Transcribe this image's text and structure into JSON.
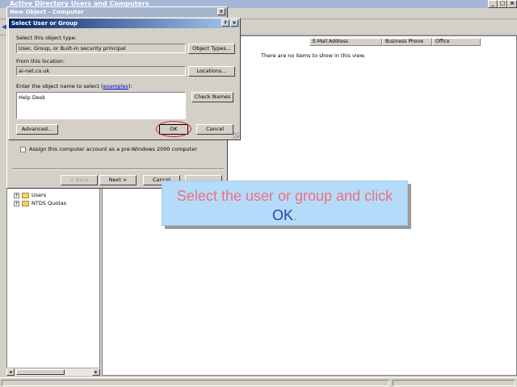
{
  "main_window": {
    "title": "Active Directory Users and Computers",
    "controls": {
      "minimize": "_",
      "maximize": "□",
      "close": "×"
    }
  },
  "tree": {
    "items": [
      {
        "expander": "+",
        "label": "Users"
      },
      {
        "expander": "+",
        "label": "NTDS Quotas"
      }
    ]
  },
  "list": {
    "columns": [
      "E-Mail Address",
      "Business Phone",
      "Office"
    ],
    "empty_message": "There are no items to show in this view."
  },
  "new_object_dialog": {
    "title": "New Object - Computer",
    "close": "×",
    "assign_label": "Assign this computer account as a pre-Windows 2000 computer",
    "back_button": "< Back",
    "next_button": "Next >",
    "cancel_button": "Cancel"
  },
  "select_dialog": {
    "title": "Select User or Group",
    "help": "?",
    "close": "×",
    "object_type_label": "Select this object type:",
    "object_type_value": "User, Group, or Built-in security principal",
    "object_types_button": "Object Types...",
    "location_label": "From this location:",
    "location_value": "ai-net.co.uk",
    "locations_button": "Locations...",
    "enter_label_prefix": "Enter the object name to select (",
    "enter_label_link": "examples",
    "enter_label_suffix": "):",
    "object_name_value": "Help Desk",
    "check_names_button": "Check Names",
    "advanced_button": "Advanced...",
    "ok_button": "OK",
    "cancel_button": "Cancel"
  },
  "callout": {
    "text_before": "Select the user or group and click ",
    "highlight": "OK",
    "text_after": ".",
    "text_color": "#f0707a",
    "highlight_color": "#2a44a8",
    "background": "#b4dcfa"
  }
}
